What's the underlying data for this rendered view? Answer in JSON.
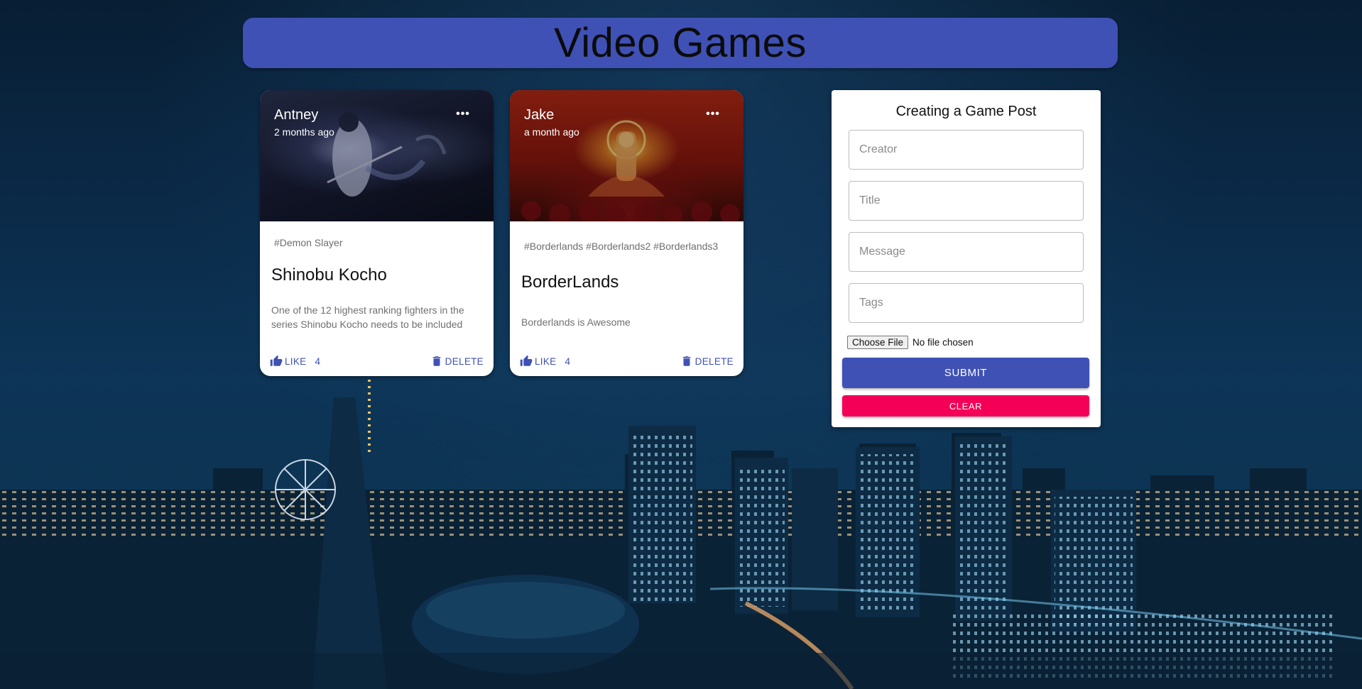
{
  "header": {
    "title": "Video Games"
  },
  "posts": [
    {
      "creator": "Antney",
      "time": "2 months ago",
      "tags": "#Demon Slayer",
      "title": "Shinobu Kocho",
      "message": "One of the 12 highest ranking fighters in the series Shinobu Kocho needs to be included",
      "like_label": "LIKE",
      "like_count": "4",
      "delete_label": "DELETE"
    },
    {
      "creator": "Jake",
      "time": "a month ago",
      "tags": "#Borderlands #Borderlands2 #Borderlands3",
      "title": "BorderLands",
      "message": "Borderlands is Awesome",
      "like_label": "LIKE",
      "like_count": "4",
      "delete_label": "DELETE"
    }
  ],
  "form": {
    "title": "Creating a Game Post",
    "creator_placeholder": "Creator",
    "title_placeholder": "Title",
    "message_placeholder": "Message",
    "tags_placeholder": "Tags",
    "choose_file_label": "Choose File",
    "no_file_text": "No file chosen",
    "submit_label": "SUBMIT",
    "clear_label": "CLEAR"
  },
  "colors": {
    "primary": "#3f51b5",
    "secondary": "#f50057",
    "background": "#0b2a48"
  }
}
